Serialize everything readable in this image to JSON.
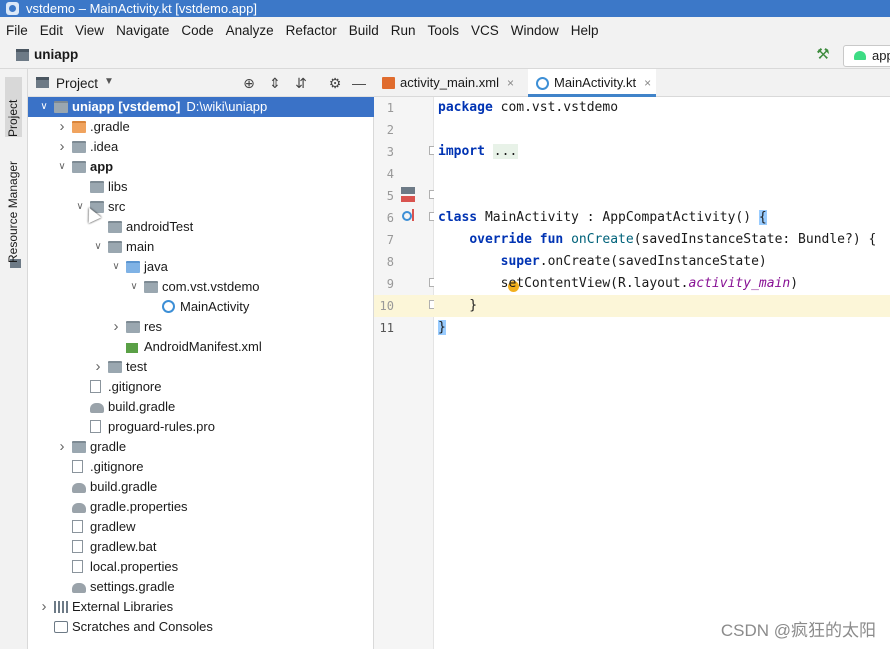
{
  "window": {
    "title": "vstdemo – MainActivity.kt [vstdemo.app]"
  },
  "menubar": {
    "items": [
      "File",
      "Edit",
      "View",
      "Navigate",
      "Code",
      "Analyze",
      "Refactor",
      "Build",
      "Run",
      "Tools",
      "VCS",
      "Window",
      "Help"
    ]
  },
  "navbar": {
    "breadcrumb": "uniapp",
    "run_config": "app"
  },
  "toolstrip": {
    "project_tab": "Project",
    "resource_tab": "Resource Manager"
  },
  "project_panel": {
    "title": "Project",
    "tree": [
      {
        "label": "uniapp [vstdemo]",
        "path": "D:\\wiki\\uniapp",
        "depth": 0,
        "arrow": "down",
        "icon": "module-folder",
        "selected": true,
        "bold": true
      },
      {
        "label": ".gradle",
        "depth": 1,
        "arrow": "right",
        "icon": "folder-orange"
      },
      {
        "label": ".idea",
        "depth": 1,
        "arrow": "right",
        "icon": "folder-grey"
      },
      {
        "label": "app",
        "depth": 1,
        "arrow": "down",
        "icon": "module-folder",
        "bold": true
      },
      {
        "label": "libs",
        "depth": 2,
        "arrow": "",
        "icon": "folder-grey"
      },
      {
        "label": "src",
        "depth": 2,
        "arrow": "down",
        "icon": "folder-grey"
      },
      {
        "label": "androidTest",
        "depth": 3,
        "arrow": "",
        "icon": "folder-grey"
      },
      {
        "label": "main",
        "depth": 3,
        "arrow": "down",
        "icon": "folder-grey"
      },
      {
        "label": "java",
        "depth": 4,
        "arrow": "down",
        "icon": "folder-blue"
      },
      {
        "label": "com.vst.vstdemo",
        "depth": 5,
        "arrow": "down",
        "icon": "package"
      },
      {
        "label": "MainActivity",
        "depth": 6,
        "arrow": "",
        "icon": "kotlin-class"
      },
      {
        "label": "res",
        "depth": 4,
        "arrow": "right",
        "icon": "res-folder"
      },
      {
        "label": "AndroidManifest.xml",
        "depth": 4,
        "arrow": "",
        "icon": "manifest"
      },
      {
        "label": "test",
        "depth": 3,
        "arrow": "right",
        "icon": "folder-grey"
      },
      {
        "label": ".gitignore",
        "depth": 2,
        "arrow": "",
        "icon": "file"
      },
      {
        "label": "build.gradle",
        "depth": 2,
        "arrow": "",
        "icon": "gradle"
      },
      {
        "label": "proguard-rules.pro",
        "depth": 2,
        "arrow": "",
        "icon": "file"
      },
      {
        "label": "gradle",
        "depth": 1,
        "arrow": "right",
        "icon": "folder-grey"
      },
      {
        "label": ".gitignore",
        "depth": 1,
        "arrow": "",
        "icon": "file"
      },
      {
        "label": "build.gradle",
        "depth": 1,
        "arrow": "",
        "icon": "gradle"
      },
      {
        "label": "gradle.properties",
        "depth": 1,
        "arrow": "",
        "icon": "gradle"
      },
      {
        "label": "gradlew",
        "depth": 1,
        "arrow": "",
        "icon": "file"
      },
      {
        "label": "gradlew.bat",
        "depth": 1,
        "arrow": "",
        "icon": "file"
      },
      {
        "label": "local.properties",
        "depth": 1,
        "arrow": "",
        "icon": "file"
      },
      {
        "label": "settings.gradle",
        "depth": 1,
        "arrow": "",
        "icon": "gradle"
      },
      {
        "label": "External Libraries",
        "depth": 0,
        "arrow": "right",
        "icon": "libraries"
      },
      {
        "label": "Scratches and Consoles",
        "depth": 0,
        "arrow": "",
        "icon": "scratches"
      }
    ]
  },
  "editor": {
    "tabs": [
      {
        "label": "activity_main.xml",
        "icon": "xml-file",
        "active": false
      },
      {
        "label": "MainActivity.kt",
        "icon": "kotlin-file",
        "active": true
      }
    ],
    "current_line": 11,
    "lines": [
      {
        "no": "1",
        "tokens": [
          {
            "t": "package",
            "c": "kw"
          },
          {
            "t": " com.vst.vstdemo",
            "c": ""
          }
        ]
      },
      {
        "no": "2",
        "tokens": []
      },
      {
        "no": "3",
        "tokens": [
          {
            "t": "import",
            "c": "kw"
          },
          {
            "t": " ",
            "c": ""
          },
          {
            "t": "...",
            "c": "fold-dots"
          }
        ]
      },
      {
        "no": "4",
        "tokens": []
      },
      {
        "no": "5",
        "tokens": []
      },
      {
        "no": "6",
        "tokens": [
          {
            "t": "class",
            "c": "kw"
          },
          {
            "t": " MainActivity : AppCompatActivity() ",
            "c": ""
          },
          {
            "t": "{",
            "c": "brace-hl"
          }
        ]
      },
      {
        "no": "7",
        "tokens": [
          {
            "t": "    ",
            "c": ""
          },
          {
            "t": "override fun",
            "c": "kw"
          },
          {
            "t": " ",
            "c": ""
          },
          {
            "t": "onCreate",
            "c": "fn"
          },
          {
            "t": "(savedInstanceState: Bundle?) {",
            "c": ""
          }
        ]
      },
      {
        "no": "8",
        "tokens": [
          {
            "t": "        ",
            "c": ""
          },
          {
            "t": "super",
            "c": "kw"
          },
          {
            "t": ".onCreate(savedInstanceState)",
            "c": ""
          }
        ]
      },
      {
        "no": "9",
        "tokens": [
          {
            "t": "        setContentView(R.layout.",
            "c": ""
          },
          {
            "t": "activity_main",
            "c": "it"
          },
          {
            "t": ")",
            "c": ""
          }
        ]
      },
      {
        "no": "10",
        "tokens": [
          {
            "t": "    }",
            "c": ""
          }
        ]
      },
      {
        "no": "11",
        "tokens": [
          {
            "t": "}",
            "c": "brace-hl"
          }
        ]
      }
    ]
  },
  "watermark": "CSDN @疯狂的太阳",
  "colors": {
    "selection": "#3a72c7",
    "keyword": "#0033b3",
    "current_line": "#fcf6d8",
    "titlebar": "#3c78c8"
  }
}
